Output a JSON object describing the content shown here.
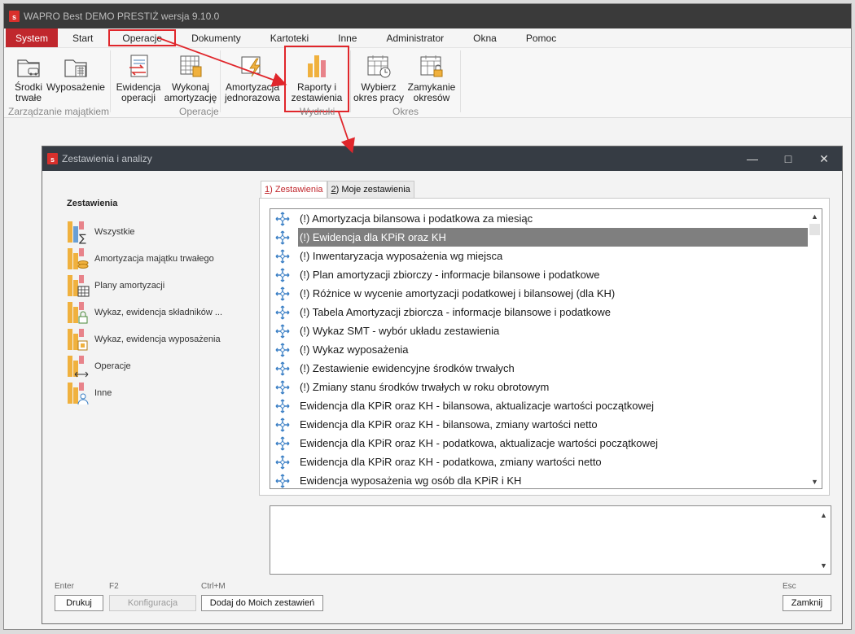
{
  "app": {
    "title": "WAPRO Best DEMO PRESTIŻ wersja 9.10.0",
    "logo_letter": "s"
  },
  "menu": [
    "System",
    "Start",
    "Operacje",
    "Dokumenty",
    "Kartoteki",
    "Inne",
    "Administrator",
    "Okna",
    "Pomoc"
  ],
  "ribbon": {
    "buttons": [
      {
        "line1": "Środki",
        "line2": "trwałe",
        "icon": "fixed-assets-icon"
      },
      {
        "line1": "Wyposażenie",
        "line2": "",
        "icon": "equipment-icon"
      },
      {
        "line1": "Ewidencja",
        "line2": "operacji",
        "icon": "operations-register-icon"
      },
      {
        "line1": "Wykonaj",
        "line2": "amortyzację",
        "icon": "run-depreciation-icon"
      },
      {
        "line1": "Amortyzacja",
        "line2": "jednorazowa",
        "icon": "one-time-depreciation-icon"
      },
      {
        "line1": "Raporty i",
        "line2": "zestawienia",
        "icon": "reports-icon"
      },
      {
        "line1": "Wybierz",
        "line2": "okres pracy",
        "icon": "calendar-clock-icon"
      },
      {
        "line1": "Zamykanie",
        "line2": "okresów",
        "icon": "calendar-lock-icon"
      }
    ],
    "groups": [
      "Zarządzanie majątkiem",
      "Operacje",
      "Wydruki",
      "Okres"
    ]
  },
  "dialog": {
    "title": "Zestawienia i analizy",
    "logo_letter": "s",
    "left_heading": "Zestawienia",
    "categories": [
      "Wszystkie",
      "Amortyzacja majątku trwałego",
      "Plany amortyzacji",
      "Wykaz, ewidencja składników ...",
      "Wykaz, ewidencja wyposażenia",
      "Operacje",
      "Inne"
    ],
    "tabs": [
      {
        "key": "1",
        "label": ") Zestawienia"
      },
      {
        "key": "2",
        "label": ") Moje zestawienia"
      }
    ],
    "reports": [
      "(!) Amortyzacja bilansowa i podatkowa za miesiąc",
      "(!) Ewidencja dla KPiR oraz KH",
      "(!) Inwentaryzacja wyposażenia wg miejsca",
      "(!) Plan amortyzacji zbiorczy - informacje bilansowe i podatkowe",
      "(!) Różnice w wycenie amortyzacji podatkowej i bilansowej (dla KH)",
      "(!) Tabela Amortyzacji zbiorcza - informacje bilansowe i podatkowe",
      "(!) Wykaz SMT - wybór układu zestawienia",
      "(!) Wykaz wyposażenia",
      "(!) Zestawienie ewidencyjne środków trwałych",
      "(!) Zmiany stanu środków trwałych w roku obrotowym",
      "Ewidencja dla KPiR oraz KH - bilansowa, aktualizacje wartości początkowej",
      "Ewidencja dla KPiR oraz KH - bilansowa, zmiany wartości netto",
      "Ewidencja dla KPiR oraz KH - podatkowa, aktualizacje wartości początkowej",
      "Ewidencja dla KPiR oraz KH - podatkowa, zmiany wartości netto",
      "Ewidencja wyposażenia wg osób dla KPiR i KH"
    ],
    "selected_report_index": 1,
    "buttons": {
      "print": {
        "hint": "Enter",
        "label": "Drukuj"
      },
      "config": {
        "hint": "F2",
        "label": "Konfiguracja"
      },
      "add_mine": {
        "hint": "Ctrl+M",
        "label": "Dodaj do Moich zestawień"
      },
      "close": {
        "hint": "Esc",
        "label": "Zamknij"
      }
    }
  },
  "colors": {
    "accent_red": "#c0272d",
    "annotation_red": "#e0262b",
    "dialog_titlebar": "#363c44",
    "selection_gray": "#7f7f7f"
  }
}
